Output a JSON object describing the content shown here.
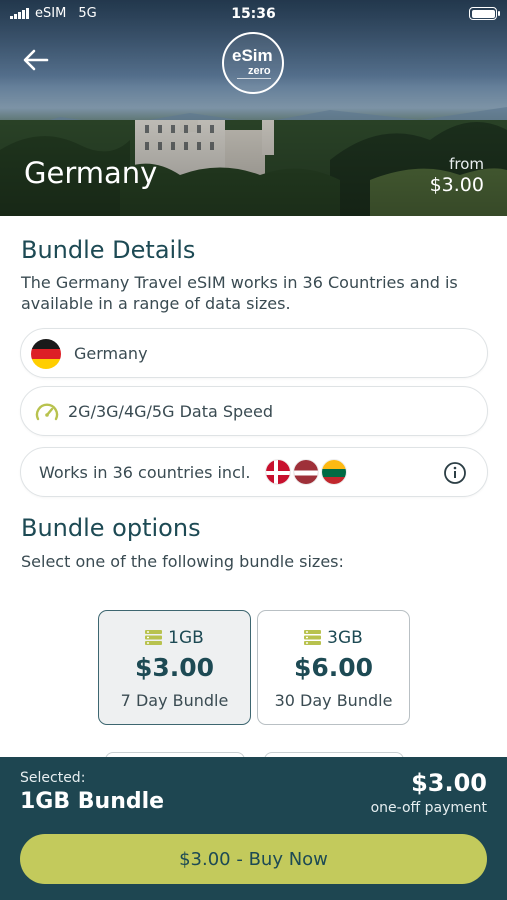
{
  "status_bar": {
    "carrier": "eSIM",
    "network": "5G",
    "time": "15:36"
  },
  "hero": {
    "logo_text_main": "eSim",
    "logo_text_sub": "zero",
    "title": "Germany",
    "from_label": "from",
    "from_price": "$3.00"
  },
  "bundle_details": {
    "title": "Bundle Details",
    "description": "The Germany Travel eSIM works in 36 Countries and is available in a range of data sizes.",
    "items": [
      {
        "label": "Germany",
        "icon": "germany-flag-icon"
      },
      {
        "label": "2G/3G/4G/5G Data Speed",
        "icon": "speedometer-icon"
      },
      {
        "label": "Works in 36 countries incl.",
        "flags": [
          "denmark",
          "latvia",
          "lithuania"
        ]
      }
    ]
  },
  "bundle_options": {
    "title": "Bundle options",
    "subtitle": "Select one of the following bundle sizes:",
    "bundles": [
      {
        "size": "1GB",
        "price": "$3.00",
        "duration": "7 Day Bundle",
        "selected": true
      },
      {
        "size": "3GB",
        "price": "$6.00",
        "duration": "30 Day Bundle",
        "selected": false
      }
    ]
  },
  "footer": {
    "selected_label": "Selected:",
    "selected_name": "1GB Bundle",
    "price": "$3.00",
    "price_note": "one-off payment",
    "buy_label": "$3.00 - Buy Now"
  },
  "colors": {
    "primary": "#1e4651",
    "accent": "#c3ca5c",
    "heading": "#1d4a54"
  }
}
